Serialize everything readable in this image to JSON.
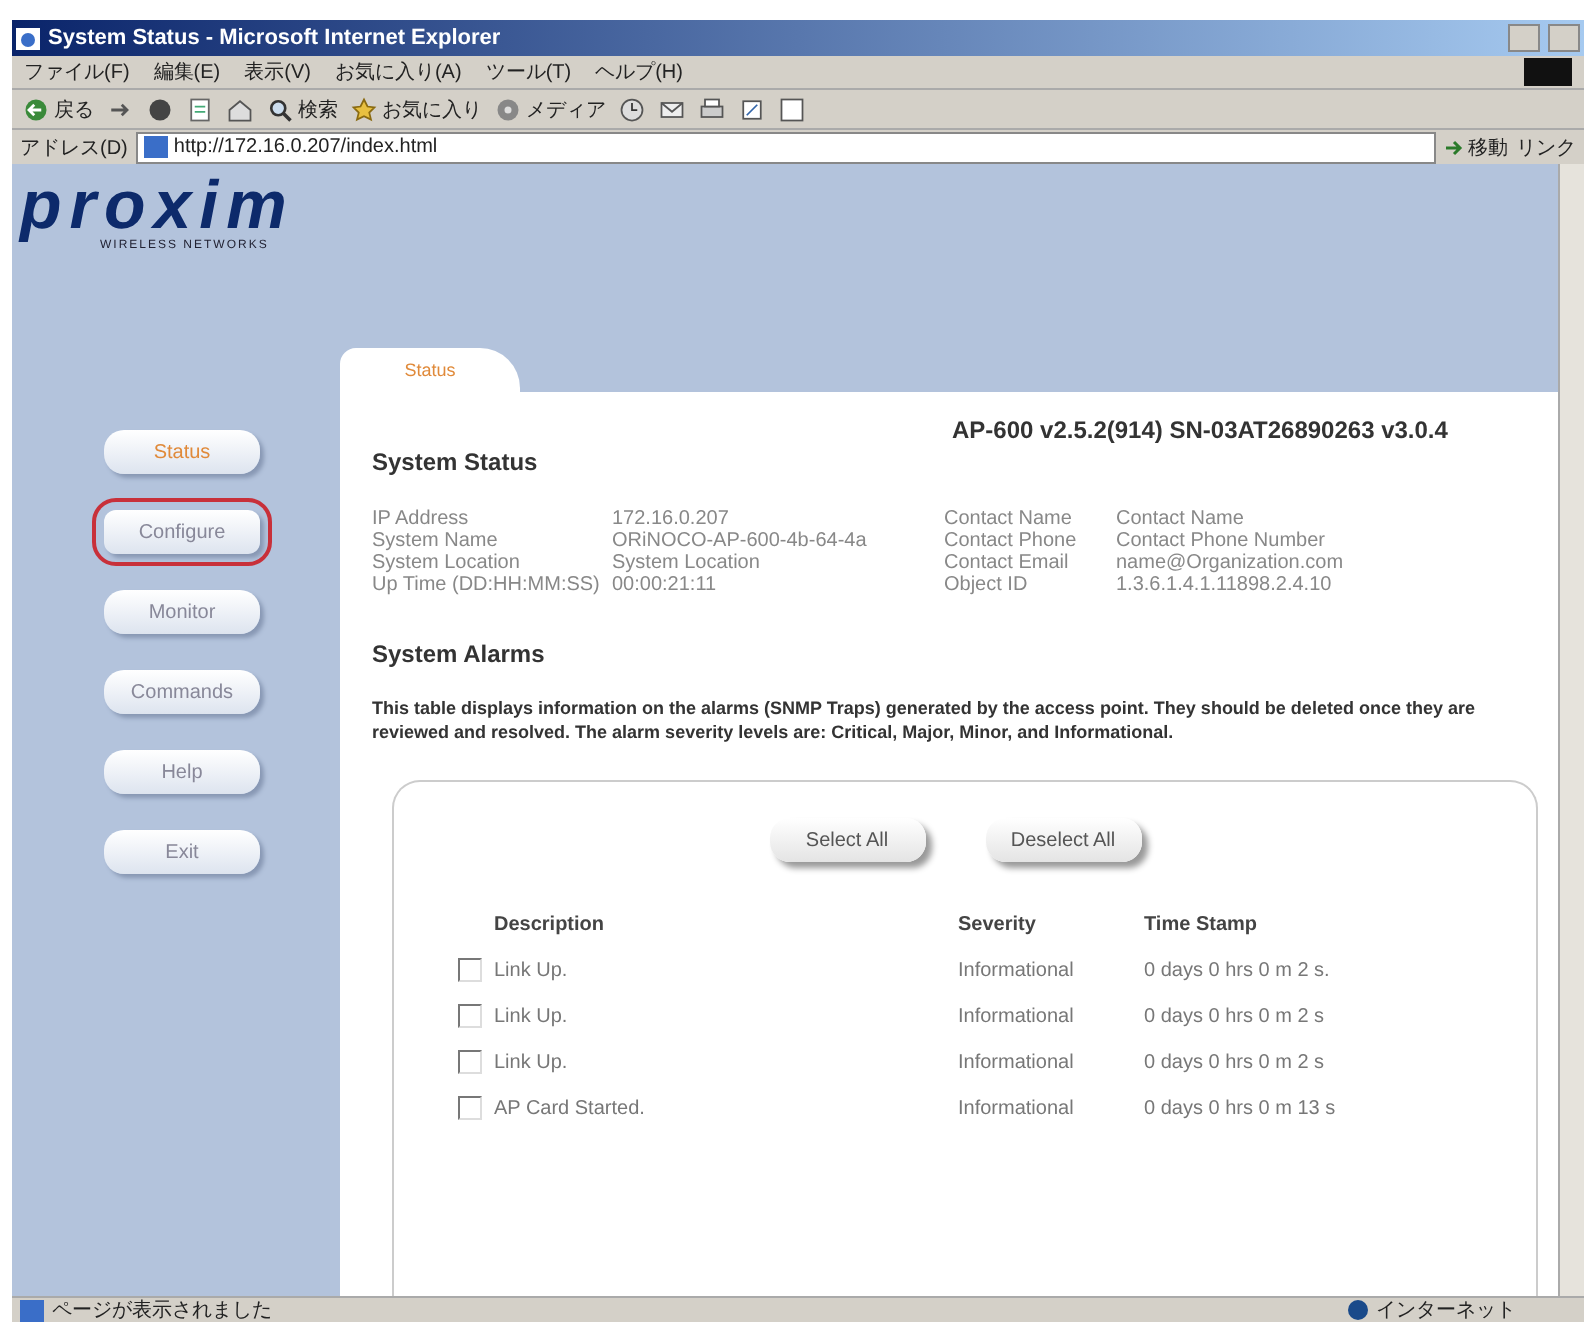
{
  "window": {
    "title": "System Status - Microsoft Internet Explorer"
  },
  "menu": [
    "ファイル(F)",
    "編集(E)",
    "表示(V)",
    "お気に入り(A)",
    "ツール(T)",
    "ヘルプ(H)"
  ],
  "toolbar": [
    {
      "kind": "back",
      "label": "戻る"
    },
    {
      "kind": "forward"
    },
    {
      "kind": "stop"
    },
    {
      "kind": "refresh"
    },
    {
      "kind": "home"
    },
    {
      "kind": "search",
      "label": "検索"
    },
    {
      "kind": "favorites",
      "label": "お気に入り"
    },
    {
      "kind": "media",
      "label": "メディア"
    },
    {
      "kind": "history"
    },
    {
      "kind": "mail"
    },
    {
      "kind": "print"
    },
    {
      "kind": "edit"
    },
    {
      "kind": "discuss"
    }
  ],
  "address_bar": {
    "label": "アドレス(D)",
    "url": "http://172.16.0.207/index.html",
    "go": "移動",
    "links": "リンク"
  },
  "logo": {
    "name": "proxim",
    "tagline": "WIRELESS NETWORKS"
  },
  "tabs": [
    {
      "label": "Status",
      "selected": true
    }
  ],
  "sidebar": [
    {
      "label": "Status",
      "selected": true,
      "highlighted": false
    },
    {
      "label": "Configure",
      "selected": false,
      "highlighted": true
    },
    {
      "label": "Monitor",
      "selected": false,
      "highlighted": false
    },
    {
      "label": "Commands",
      "selected": false,
      "highlighted": false
    },
    {
      "label": "Help",
      "selected": false,
      "highlighted": false
    },
    {
      "label": "Exit",
      "selected": false,
      "highlighted": false
    }
  ],
  "system_status": {
    "title": "System Status",
    "version": "AP-600 v2.5.2(914) SN-03AT26890263 v3.0.4",
    "left": [
      {
        "label": "IP Address",
        "value": "172.16.0.207"
      },
      {
        "label": "System Name",
        "value": "ORiNOCO-AP-600-4b-64-4a"
      },
      {
        "label": "System Location",
        "value": "System Location"
      },
      {
        "label": "Up Time (DD:HH:MM:SS)",
        "value": "00:00:21:11"
      }
    ],
    "right": [
      {
        "label": "Contact Name",
        "value": "Contact Name"
      },
      {
        "label": "Contact Phone",
        "value": "Contact Phone Number"
      },
      {
        "label": "Contact Email",
        "value": "name@Organization.com"
      },
      {
        "label": "Object ID",
        "value": "1.3.6.1.4.1.11898.2.4.10"
      }
    ]
  },
  "system_alarms": {
    "title": "System Alarms",
    "description": "This table displays information on the alarms (SNMP Traps) generated by the access point. They should be deleted once they are reviewed and resolved. The alarm severity levels are: Critical, Major, Minor, and Informational.",
    "buttons": [
      "Select All",
      "Deselect All"
    ],
    "columns": [
      "Description",
      "Severity",
      "Time Stamp"
    ],
    "rows": [
      {
        "checked": false,
        "description": "Link Up.",
        "severity": "Informational",
        "time": "0 days 0 hrs 0 m 2 s."
      },
      {
        "checked": false,
        "description": "Link Up.",
        "severity": "Informational",
        "time": "0 days 0 hrs 0 m 2 s"
      },
      {
        "checked": false,
        "description": "Link Up.",
        "severity": "Informational",
        "time": "0 days 0 hrs 0 m 2 s"
      },
      {
        "checked": false,
        "description": "AP Card Started.",
        "severity": "Informational",
        "time": "0 days 0 hrs 0 m 13 s"
      }
    ]
  },
  "status_bar": {
    "message": "ページが表示されました",
    "zone": "インターネット"
  }
}
